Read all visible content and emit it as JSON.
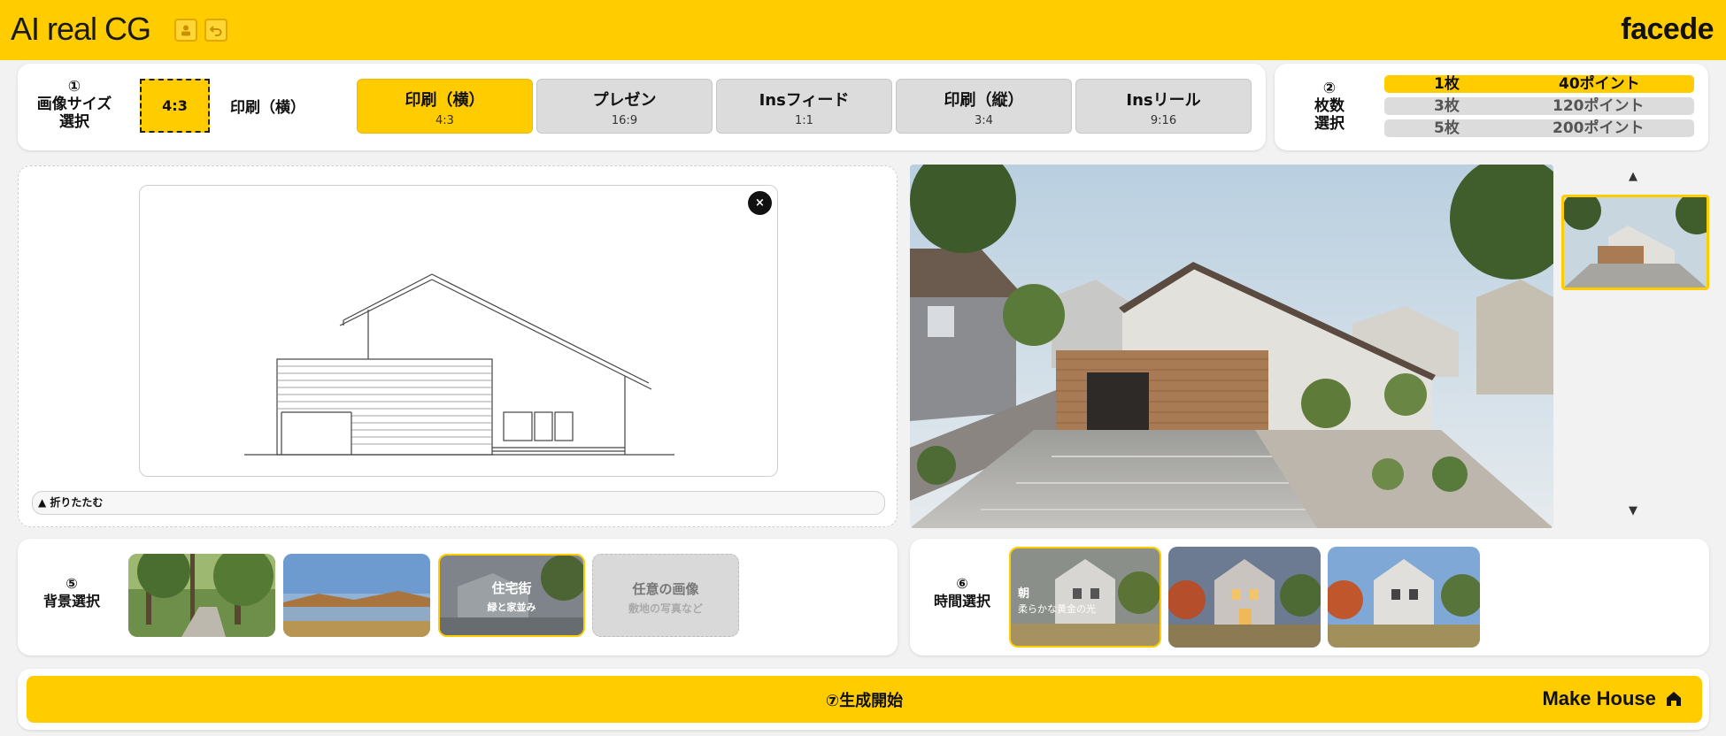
{
  "header": {
    "app_title": "AI real CG",
    "logo": "facede",
    "icons": [
      "user-icon",
      "undo-icon"
    ]
  },
  "size_select": {
    "step": "①",
    "label_line1": "画像サイズ",
    "label_line2": "選択",
    "current_ratio": "4:3",
    "current_name": "印刷（横）",
    "options": [
      {
        "title": "印刷（横）",
        "ratio": "4:3",
        "active": true
      },
      {
        "title": "プレゼン",
        "ratio": "16:9",
        "active": false
      },
      {
        "title": "Insフィード",
        "ratio": "1:1",
        "active": false
      },
      {
        "title": "印刷（縦）",
        "ratio": "3:4",
        "active": false
      },
      {
        "title": "Insリール",
        "ratio": "9:16",
        "active": false
      }
    ]
  },
  "count_select": {
    "step": "②",
    "label_line1": "枚数",
    "label_line2": "選択",
    "options": [
      {
        "count": "1枚",
        "points": "40ポイント",
        "active": true
      },
      {
        "count": "3枚",
        "points": "120ポイント",
        "active": false
      },
      {
        "count": "5枚",
        "points": "200ポイント",
        "active": false
      }
    ]
  },
  "drawing": {
    "close": "×",
    "collapse_label": "▲ 折りたたむ"
  },
  "result_nav": {
    "up": "▲",
    "down": "▼"
  },
  "background_select": {
    "step": "⑤",
    "label": "背景選択",
    "options": [
      {
        "name": "forest",
        "title": "",
        "sub": ""
      },
      {
        "name": "lake",
        "title": "",
        "sub": ""
      },
      {
        "name": "residential",
        "title": "住宅街",
        "sub": "緑と家並み"
      },
      {
        "name": "custom",
        "title": "任意の画像",
        "sub": "敷地の写真など"
      }
    ]
  },
  "time_select": {
    "step": "⑥",
    "label": "時間選択",
    "options": [
      {
        "title": "朝",
        "sub": "柔らかな黄金の光"
      },
      {
        "title": "",
        "sub": ""
      },
      {
        "title": "",
        "sub": ""
      }
    ]
  },
  "generate": {
    "label": "⑦生成開始",
    "make_house": "Make House"
  },
  "colors": {
    "accent": "#ffcc00",
    "segment_inactive": "#dcdcdc"
  }
}
